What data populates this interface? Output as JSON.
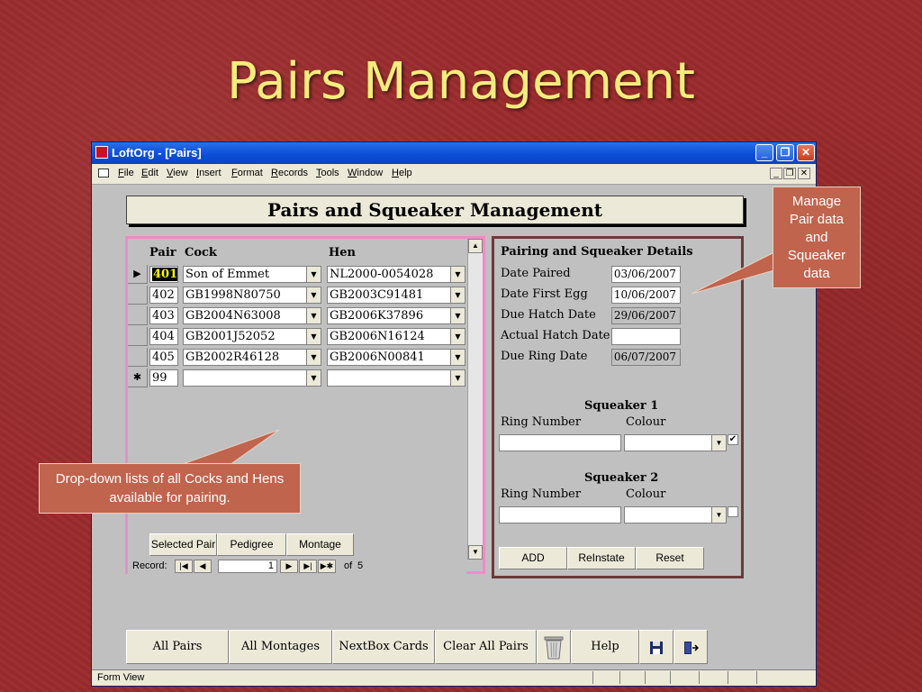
{
  "slide": {
    "title": "Pairs Management"
  },
  "window": {
    "title": "LoftOrg - [Pairs]",
    "minimize": "_",
    "restore": "❐",
    "close": "✕"
  },
  "menu": [
    "File",
    "Edit",
    "View",
    "Insert",
    "Format",
    "Records",
    "Tools",
    "Window",
    "Help"
  ],
  "form": {
    "title": "Pairs and Squeaker Management"
  },
  "pairs": {
    "headers": {
      "pair": "Pair",
      "cock": "Cock",
      "hen": "Hen"
    },
    "rows": [
      {
        "pair": "401",
        "cock": "Son of Emmet",
        "hen": "NL2000-0054028"
      },
      {
        "pair": "402",
        "cock": "GB1998N80750",
        "hen": "GB2003C91481"
      },
      {
        "pair": "403",
        "cock": "GB2004N63008",
        "hen": "GB2006K37896"
      },
      {
        "pair": "404",
        "cock": "GB2001J52052",
        "hen": "GB2006N16124"
      },
      {
        "pair": "405",
        "cock": "GB2002R46128",
        "hen": "GB2006N00841"
      }
    ],
    "new_row": {
      "pair": "99",
      "cock": "",
      "hen": ""
    },
    "buttons": {
      "selected_pair": "Selected Pair",
      "pedigree": "Pedigree",
      "montage": "Montage"
    },
    "nav": {
      "label": "Record:",
      "current": "1",
      "of_label": "of",
      "total": "5"
    }
  },
  "details": {
    "heading": "Pairing and Squeaker Details",
    "fields": [
      {
        "label": "Date Paired",
        "value": "03/06/2007",
        "readonly": false
      },
      {
        "label": "Date First Egg",
        "value": "10/06/2007",
        "readonly": false
      },
      {
        "label": "Due Hatch Date",
        "value": "29/06/2007",
        "readonly": true
      },
      {
        "label": "Actual Hatch Date",
        "value": "",
        "readonly": false
      },
      {
        "label": "Due Ring Date",
        "value": "06/07/2007",
        "readonly": true
      }
    ],
    "squeaker1": {
      "heading": "Squeaker 1",
      "ring_label": "Ring Number",
      "colour_label": "Colour",
      "checked": true
    },
    "squeaker2": {
      "heading": "Squeaker 2",
      "ring_label": "Ring Number",
      "colour_label": "Colour",
      "checked": false
    },
    "buttons": {
      "add": "ADD",
      "reinstate": "ReInstate",
      "reset": "Reset"
    }
  },
  "toolbar": {
    "all_pairs": "All Pairs",
    "all_montages": "All Montages",
    "nextbox_cards": "NextBox Cards",
    "clear_all_pairs": "Clear All Pairs",
    "help": "Help"
  },
  "status": {
    "text": "Form View"
  },
  "callouts": {
    "left": "Drop-down lists of all Cocks and Hens available for pairing.",
    "right": "Manage Pair data and Squeaker data"
  },
  "icons": [
    "trash-icon",
    "save-icon",
    "exit-door-icon",
    "record-selector-icon",
    "dropdown-arrow-icon"
  ]
}
